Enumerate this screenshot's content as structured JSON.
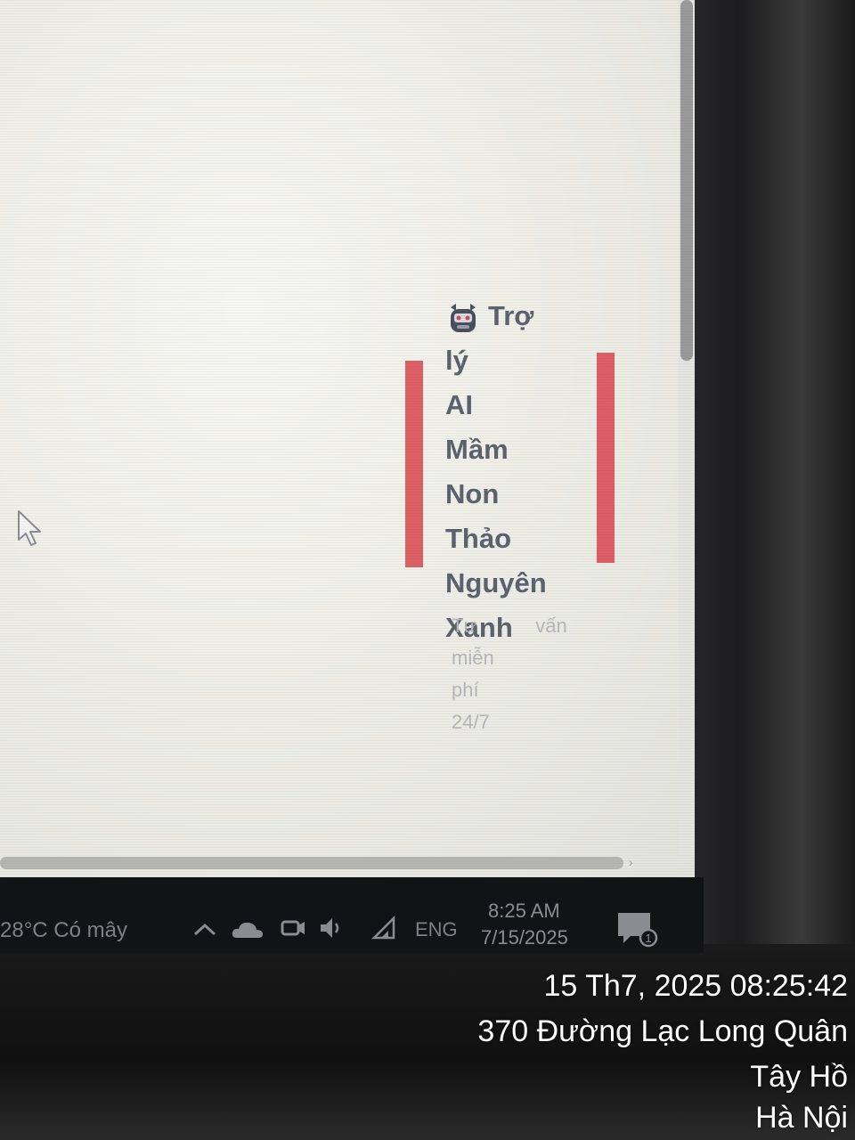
{
  "widget": {
    "icon": "robot-icon",
    "title": "Trợ lý AI Mầm Non Thảo Nguyên Xanh",
    "subtitle": "Tư vấn miễn phí 24/7",
    "accent_color": "#d9474f"
  },
  "taskbar": {
    "weather": "28°C  Có mây",
    "language": "ENG",
    "time": "8:25 AM",
    "date": "7/15/2025"
  },
  "overlay": {
    "datetime": "15 Th7, 2025 08:25:42",
    "address": "370 Đường Lạc Long Quân",
    "district": "Tây Hồ",
    "city": "Hà Nội"
  }
}
